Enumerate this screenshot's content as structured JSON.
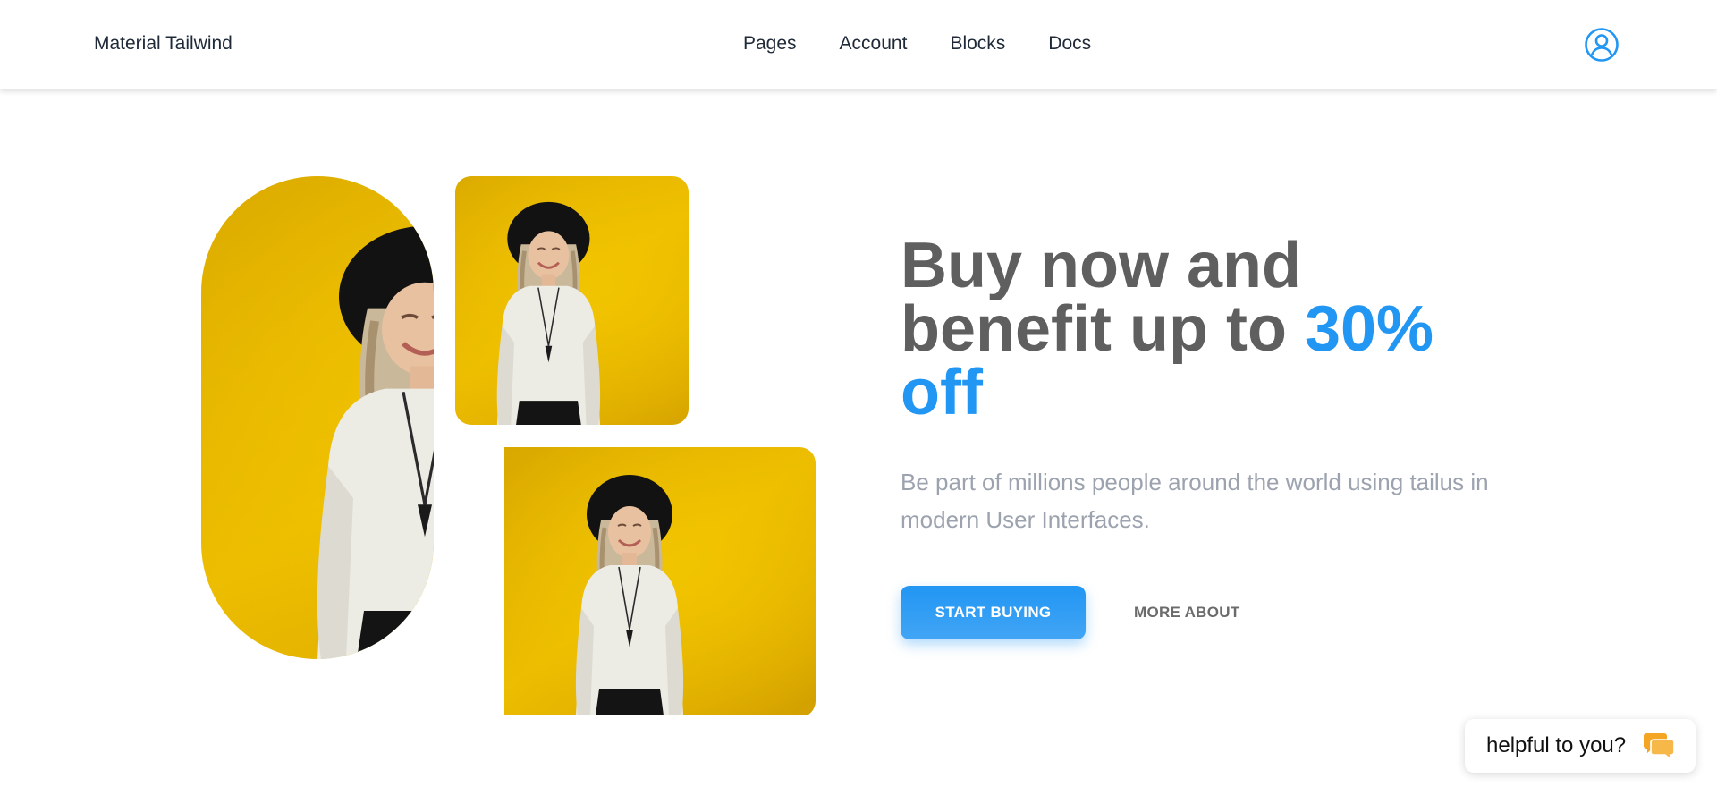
{
  "navbar": {
    "brand": "Material Tailwind",
    "links": [
      "Pages",
      "Account",
      "Blocks",
      "Docs"
    ],
    "user_icon": "user-circle-icon"
  },
  "hero": {
    "headline_part1": "Buy now and benefit up to ",
    "headline_highlight": "30% off",
    "subtext": "Be part of millions people around the world using tailus in modern User Interfaces.",
    "primary_button": "START BUYING",
    "secondary_button": "MORE ABOUT",
    "images": [
      "photo-woman-yellow-wall",
      "photo-woman-yellow-wall",
      "photo-woman-yellow-wall"
    ]
  },
  "help_widget": {
    "label": "helpful to you?",
    "icon": "chat-bubbles-icon"
  },
  "colors": {
    "accent": "#2196f3",
    "heading": "#5f5f5f",
    "muted_text": "#9ca3af",
    "photo_background": "#e9b800",
    "chat_icon": "#f5a524"
  }
}
